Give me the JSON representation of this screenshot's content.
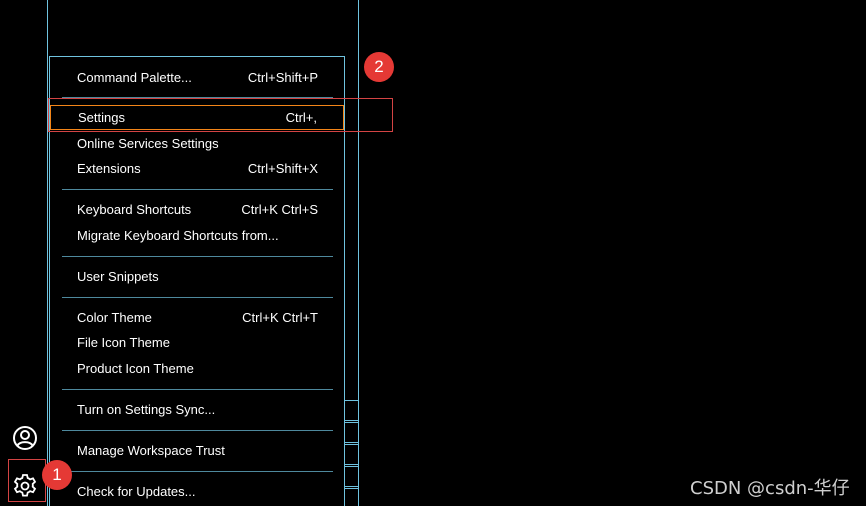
{
  "menu": {
    "items": [
      {
        "label": "Command Palette...",
        "shortcut": "Ctrl+Shift+P"
      },
      {
        "label": "Settings",
        "shortcut": "Ctrl+,"
      },
      {
        "label": "Online Services Settings",
        "shortcut": ""
      },
      {
        "label": "Extensions",
        "shortcut": "Ctrl+Shift+X"
      },
      {
        "label": "Keyboard Shortcuts",
        "shortcut": "Ctrl+K Ctrl+S"
      },
      {
        "label": "Migrate Keyboard Shortcuts from...",
        "shortcut": ""
      },
      {
        "label": "User Snippets",
        "shortcut": ""
      },
      {
        "label": "Color Theme",
        "shortcut": "Ctrl+K Ctrl+T"
      },
      {
        "label": "File Icon Theme",
        "shortcut": ""
      },
      {
        "label": "Product Icon Theme",
        "shortcut": ""
      },
      {
        "label": "Turn on Settings Sync...",
        "shortcut": ""
      },
      {
        "label": "Manage Workspace Trust",
        "shortcut": ""
      },
      {
        "label": "Check for Updates...",
        "shortcut": ""
      }
    ],
    "selected_index": 1
  },
  "activity_bar": {
    "icons": [
      "account-icon",
      "gear-icon"
    ]
  },
  "annotations": {
    "badge_1": "1",
    "badge_2": "2"
  },
  "watermark": "CSDN @csdn-华仔",
  "colors": {
    "background": "#000000",
    "border": "#6fc3df",
    "focus": "#f38518",
    "annotation_red": "#e53935"
  }
}
